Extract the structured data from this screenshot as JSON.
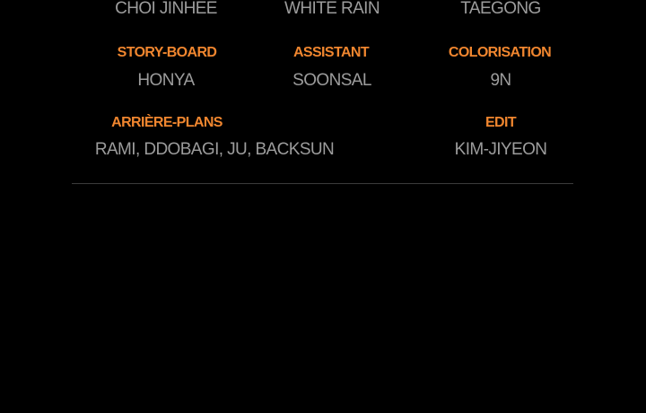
{
  "credits": {
    "top_row": [
      "CHOI JINHEE",
      "WHITE RAIN",
      "TAEGONG"
    ],
    "storyboard": {
      "role": "STORY-BOARD",
      "name": "HONYA"
    },
    "assistant": {
      "role": "ASSISTANT",
      "name": "SOONSAL"
    },
    "colorisation": {
      "role": "COLORISATION",
      "name": "9N"
    },
    "backgrounds": {
      "role": "ARRIÈRE-PLANS",
      "name": "RAMI, DDOBAGI, JU,  BACKSUN"
    },
    "edit": {
      "role": "EDIT",
      "name": "KIM-JIYEON"
    }
  },
  "colors": {
    "background": "#000000",
    "role_label": "#f0862f",
    "name_text": "#9c9c9c",
    "divider": "#3b3b3b"
  }
}
